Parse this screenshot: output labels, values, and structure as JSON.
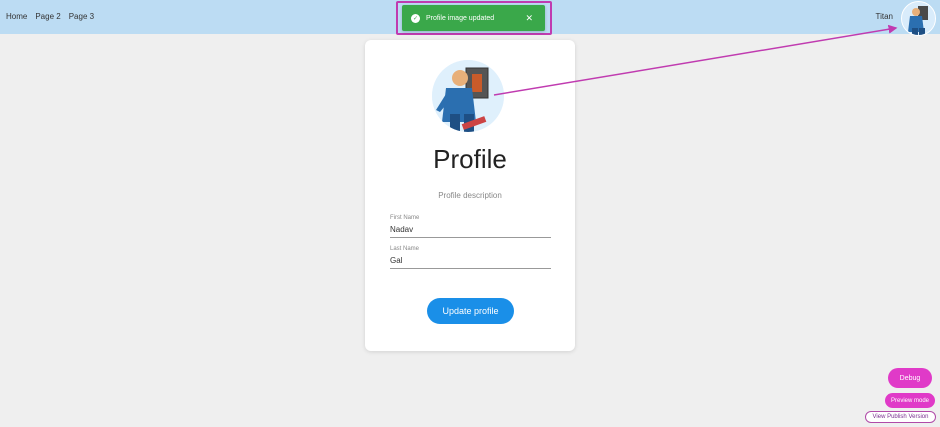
{
  "nav": {
    "items": [
      {
        "label": "Home"
      },
      {
        "label": "Page 2"
      },
      {
        "label": "Page 3"
      }
    ]
  },
  "header": {
    "username": "Titan"
  },
  "toast": {
    "message": "Profile image updated",
    "close_icon": "close-icon",
    "status_icon": "check-circle-icon"
  },
  "profile": {
    "title": "Profile",
    "description": "Profile description",
    "first_name": {
      "label": "First Name",
      "value": "Nadav"
    },
    "last_name": {
      "label": "Last Name",
      "value": "Gal"
    },
    "update_label": "Update profile"
  },
  "dev_tools": {
    "debug_label": "Debug",
    "preview_label": "Preview mode",
    "publish_label": "View Publish Version"
  },
  "colors": {
    "topbar": "#bcdcf3",
    "toast": "#3aa84a",
    "primary": "#1a8fe8",
    "annotation": "#c03bb0",
    "dev_button": "#e03ac8"
  }
}
